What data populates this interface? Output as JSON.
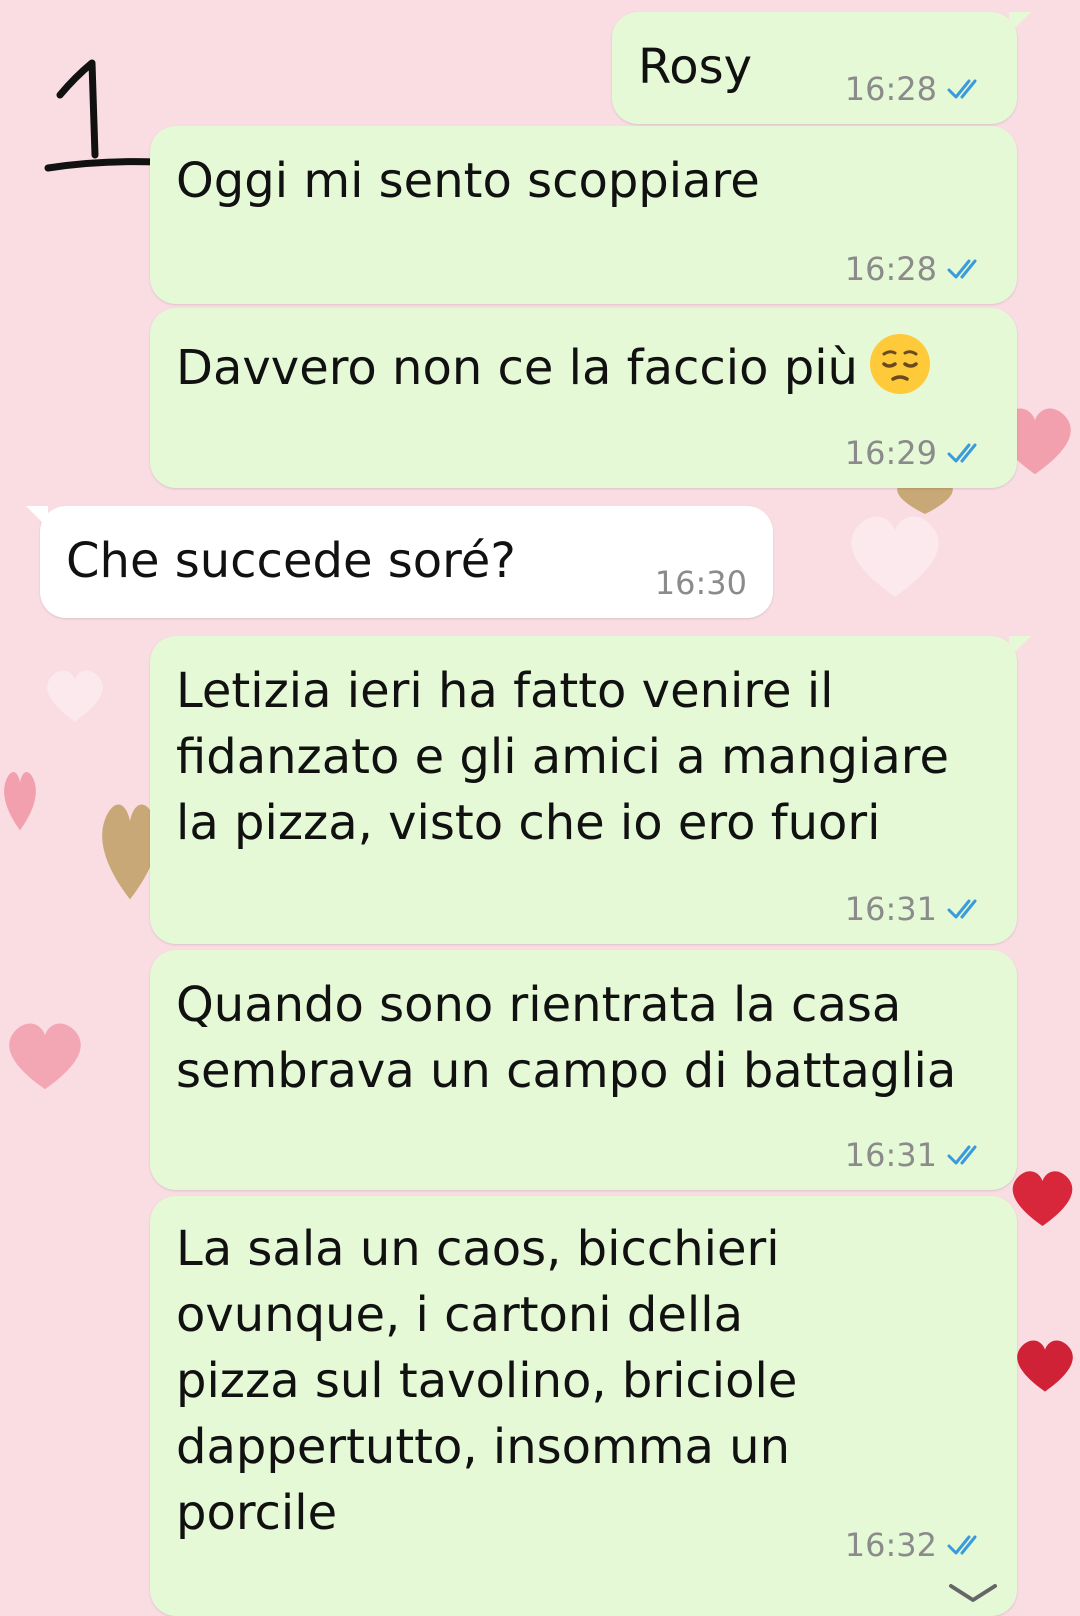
{
  "annotation": {
    "number": "1"
  },
  "colors": {
    "outgoing_bubble": "#e5f9d7",
    "incoming_bubble": "#ffffff",
    "read_ticks": "#3a9bdc",
    "timestamp": "#8b8b8b",
    "background": "#f9dde3"
  },
  "messages": [
    {
      "direction": "outgoing",
      "text": "Rosy",
      "time": "16:28",
      "status": "read"
    },
    {
      "direction": "outgoing",
      "text": "Oggi mi sento scoppiare",
      "time": "16:28",
      "status": "read"
    },
    {
      "direction": "outgoing",
      "text": "Davvero non ce la faccio più",
      "emoji": "pensive-face",
      "time": "16:29",
      "status": "read"
    },
    {
      "direction": "incoming",
      "text": "Che succede soré?",
      "time": "16:30"
    },
    {
      "direction": "outgoing",
      "text": "Letizia ieri ha fatto venire il\nfidanzato e gli amici a mangiare\nla pizza, visto che io ero fuori",
      "time": "16:31",
      "status": "read"
    },
    {
      "direction": "outgoing",
      "text": "Quando sono rientrata la casa\nsembrava un campo di battaglia",
      "time": "16:31",
      "status": "read"
    },
    {
      "direction": "outgoing",
      "text": "La sala un caos, bicchieri\novunque, i cartoni della\npizza sul tavolino, briciole\ndappertutto, insomma un\nporcile",
      "time": "16:32",
      "status": "read"
    }
  ]
}
